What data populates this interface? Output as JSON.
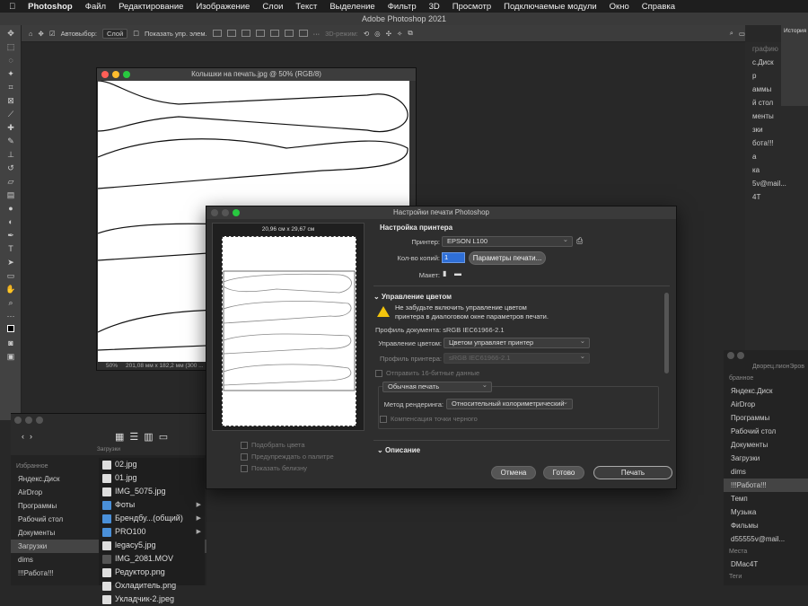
{
  "menubar": {
    "app": "Photoshop",
    "items": [
      "Файл",
      "Редактирование",
      "Изображение",
      "Слои",
      "Текст",
      "Выделение",
      "Фильтр",
      "3D",
      "Просмотр",
      "Подключаемые модули",
      "Окно",
      "Справка"
    ]
  },
  "ps_title": "Adobe Photoshop 2021",
  "options": {
    "autoselect": "Автовыбор:",
    "layer": "Слой",
    "show_transform": "Показать упр. элем.",
    "mode3d": "3D-режим:"
  },
  "document": {
    "title": "Колышки на печать.jpg @ 50% (RGB/8)",
    "zoom": "50%",
    "size": "201,08 мм x 182,2 мм (300 ..."
  },
  "right_panel": {
    "history": "История",
    "partial": [
      "графию",
      "с.Диск",
      "р",
      "аммы",
      "й стол",
      "менты",
      "зки",
      "ботa!!!",
      "а",
      "ка",
      "5v@mail...",
      "4T"
    ]
  },
  "finder_left": {
    "toolbar_label": "Загрузки",
    "favorites_header": "Избранное",
    "favorites": [
      "Яндекс.Диск",
      "AirDrop",
      "Программы",
      "Рабочий стол",
      "Документы",
      "Загрузки",
      "dims",
      "!!!Работа!!!"
    ],
    "files": [
      "02.jpg",
      "01.jpg",
      "IMG_5075.jpg",
      "Фоты",
      "Брендбу...(общий)",
      "PRO100",
      "legacy5.jpg",
      "IMG_2081.MOV",
      "Редуктор.png",
      "Охладитель.png",
      "Укладчик-2.jpeg"
    ]
  },
  "finder_right": {
    "header": "Дворец.пионЭров",
    "favorites_header": "бранное",
    "items": [
      "Яндекс.Диск",
      "AirDrop",
      "Программы",
      "Рабочий стол",
      "Документы",
      "Загрузки",
      "dims",
      "!!!Работа!!!",
      "Темп",
      "Музыка",
      "Фильмы",
      "d55555v@mail..."
    ],
    "places_header": "Места",
    "places": [
      "DMac4T"
    ],
    "tags_header": "Теги"
  },
  "dialog": {
    "title": "Настройки печати Photoshop",
    "paper_size": "20,96 см x 29,67 см",
    "checks": [
      "Подобрать цвета",
      "Предупреждать о палитре",
      "Показать белизну"
    ],
    "printer_setup": "Настройка принтера",
    "printer_label": "Принтер:",
    "printer_value": "EPSON L100",
    "copies_label": "Кол-во копий:",
    "copies_value": "1",
    "print_params": "Параметры печати...",
    "layout_label": "Макет:",
    "color_mgmt": "Управление цветом",
    "warning_l1": "Не забудьте включить управление цветом",
    "warning_l2": "принтера в диалоговом окне параметров печати.",
    "doc_profile": "Профиль документа: sRGB IEC61966-2.1",
    "cm_label": "Управление цветом:",
    "cm_value": "Цветом управляет принтер",
    "printer_profile_label": "Профиль принтера:",
    "printer_profile_value": "sRGB IEC61966-2.1",
    "send16": "Отправить 16-битные данные",
    "normal_print": "Обычная печать",
    "render_label": "Метод рендеринга:",
    "render_value": "Относительный колориметрический",
    "bpc": "Компенсация точки черного",
    "description": "Описание",
    "cancel": "Отмена",
    "done": "Готово",
    "print": "Печать"
  },
  "colors": {
    "accent": "#2f6fd6",
    "warning": "#f2c40c",
    "close": "#ff5f57",
    "min": "#febc2e",
    "max": "#28c840"
  }
}
